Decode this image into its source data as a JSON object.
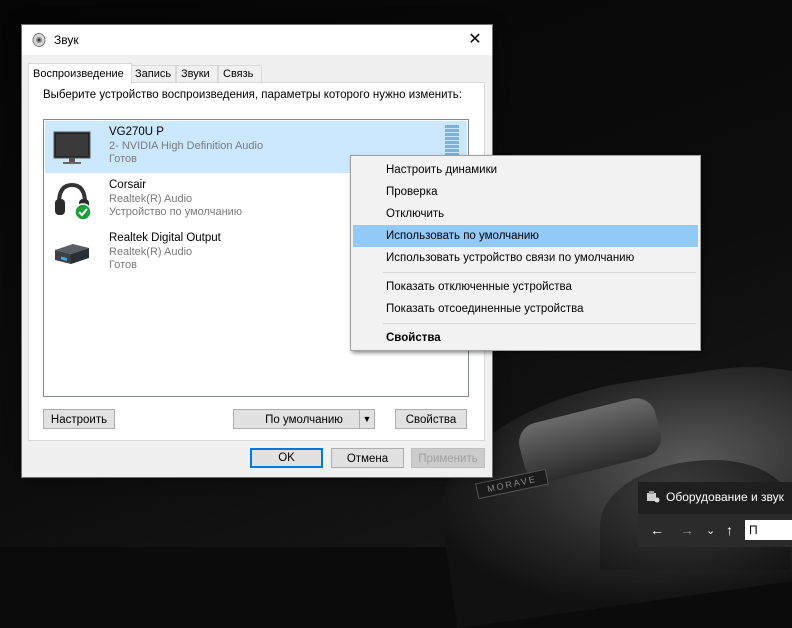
{
  "window": {
    "title": "Звук",
    "close_glyph": "✕"
  },
  "tabs": [
    {
      "label": "Воспроизведение",
      "active": true
    },
    {
      "label": "Запись",
      "active": false
    },
    {
      "label": "Звуки",
      "active": false
    },
    {
      "label": "Связь",
      "active": false
    }
  ],
  "instruction": "Выберите устройство воспроизведения, параметры которого нужно изменить:",
  "devices": [
    {
      "name": "VG270U P",
      "line1": "2- NVIDIA High Definition Audio",
      "line2": "Готов",
      "icon": "monitor-icon",
      "selected": true
    },
    {
      "name": "Corsair",
      "line1": "Realtek(R) Audio",
      "line2": "Устройство по умолчанию",
      "icon": "headphones-icon",
      "selected": false
    },
    {
      "name": "Realtek Digital Output",
      "line1": "Realtek(R) Audio",
      "line2": "Готов",
      "icon": "digital-output-icon",
      "selected": false
    }
  ],
  "buttons": {
    "configure": "Настроить",
    "set_default": "По умолчанию",
    "properties": "Свойства",
    "ok": "OK",
    "cancel": "Отмена",
    "apply": "Применить"
  },
  "context_menu": {
    "items": [
      {
        "label": "Настроить динамики"
      },
      {
        "label": "Проверка"
      },
      {
        "label": "Отключить"
      },
      {
        "label": "Использовать по умолчанию",
        "highlighted": true
      },
      {
        "label": "Использовать устройство связи по умолчанию"
      },
      {
        "label": "Показать отключенные устройства"
      },
      {
        "label": "Показать отсоединенные устройства"
      },
      {
        "label": "Свойства",
        "bold": true
      }
    ]
  },
  "explorer": {
    "title": "Оборудование и звук",
    "path": "П",
    "back": "←",
    "forward": "→",
    "down": "⌄",
    "up": "↑"
  },
  "wallpaper": {
    "plate_text": "MORAVE"
  },
  "colors": {
    "selection": "#cce8ff",
    "menu_highlight": "#91c9f7",
    "accent": "#0078d7",
    "check_green": "#1e9e3a"
  }
}
